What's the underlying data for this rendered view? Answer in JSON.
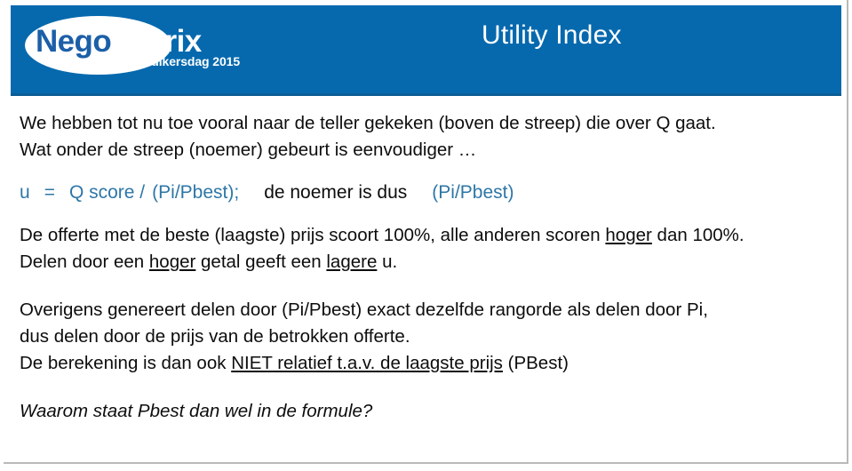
{
  "slide": {
    "title": "Utility Index",
    "header_color": "#0669AE",
    "accent_blue": "#2E77A6",
    "body_text_color": "#0d0d0d"
  },
  "logo": {
    "word_part1": "Nego",
    "word_part2": "metrix",
    "tagline": "Gebruikersdag 2015",
    "part1_color": "#1C5FA8",
    "part2_color": "#FFFFFF"
  },
  "body": {
    "para1": {
      "line1": "We hebben tot nu toe vooral naar de teller gekeken (boven de streep) die over Q gaat.",
      "line2": "Wat onder de streep (noemer) gebeurt is eenvoudiger …"
    },
    "formula": {
      "u": "u",
      "equals": "=",
      "numerator": "Q score /",
      "denominator": "(Pi/Pbest);",
      "explain": "de noemer is dus",
      "denominator2": "(Pi/Pbest)"
    },
    "para2": {
      "line1_a": "De offerte met de beste (laagste) prijs scoort 100%, alle anderen scoren ",
      "line1_underline": "hoger",
      "line1_b": " dan 100%.",
      "line2_a": "Delen door een ",
      "line2_underline1": "hoger",
      "line2_b": " getal geeft een ",
      "line2_underline2": "lagere",
      "line2_c": " u."
    },
    "para3": {
      "line1": "Overigens genereert delen door (Pi/Pbest) exact dezelfde rangorde als delen door Pi,",
      "line2": "dus delen door de prijs van de betrokken offerte.",
      "line3_a": "De berekening is dan ook ",
      "line3_underline": "NIET  relatief t.a.v. de laagste prijs",
      "line3_b": " (PBest)"
    },
    "para4": {
      "line1": "Waarom staat Pbest dan wel in de formule?"
    }
  }
}
